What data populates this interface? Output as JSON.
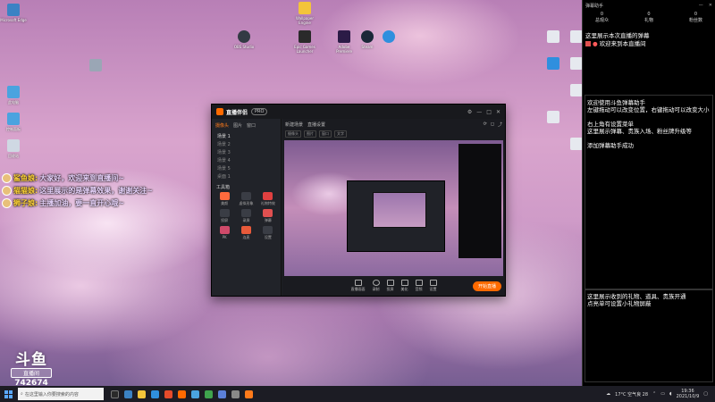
{
  "desktop": {
    "left_icons": [
      {
        "label": "Microsoft Edge",
        "color": "#3b82c4"
      },
      {
        "label": "",
        "color": "#9aa6b5"
      },
      {
        "label": "此电脑",
        "color": "#4aa3df"
      },
      {
        "label": "控制面板",
        "color": "#4aa3df"
      },
      {
        "label": "回收站",
        "color": "#cfd8e3"
      }
    ],
    "top_icons": [
      {
        "label": "OBS Studio",
        "color": "#333a44"
      },
      {
        "label": "Wallpaper Engine",
        "color": "#f3c43a"
      },
      {
        "label": "Epic Games Launcher",
        "color": "#2a2a2a"
      },
      {
        "label": "Adobe Premiere",
        "color": "#2b1b46"
      },
      {
        "label": "Steam",
        "color": "#1b2838"
      },
      {
        "label": "",
        "color": "#2f8fde"
      }
    ],
    "right_icons": [
      {
        "label": "",
        "color": "#e6e9ef"
      },
      {
        "label": "",
        "color": "#e6e9ef"
      },
      {
        "label": "",
        "color": "#2f8fde"
      },
      {
        "label": "",
        "color": "#e6e9ef"
      },
      {
        "label": "",
        "color": "#e6e9ef"
      },
      {
        "label": "",
        "color": "#e6e9ef"
      },
      {
        "label": "",
        "color": "#e6e9ef"
      }
    ]
  },
  "danmaku": [
    {
      "name": "鲨鱼娘:",
      "text": "大家好，欢迎来到直播间~"
    },
    {
      "name": "猫猫娘:",
      "text": "这里展示的是弹幕效果，谢谢关注~"
    },
    {
      "name": "狮子娘:",
      "text": "主播加油，要一直开心哦~"
    }
  ],
  "watermark": {
    "brand": "斗鱼",
    "sub": "直播间",
    "room_id": "742674"
  },
  "companion": {
    "title": "直播伴侣",
    "tag": "PRO",
    "tabs": [
      "摄像头",
      "图片",
      "窗口"
    ],
    "scenes": [
      "场景 1",
      "场景 2",
      "场景 3",
      "场景 4",
      "场景 5",
      "桌面 1"
    ],
    "tools_title": "工具箱",
    "tools": [
      "美颜",
      "虚拟形象",
      "礼物特效",
      "投屏",
      "录屏",
      "弹幕",
      "PK",
      "连麦",
      "设置"
    ],
    "topbar": [
      "新建场景",
      "直播设置"
    ],
    "toolrow": [
      "摄像头",
      "图片",
      "窗口",
      "文字"
    ],
    "bottom": [
      "直播画面",
      "录制",
      "投屏",
      "美化",
      "音频",
      "设置"
    ],
    "start_label": "开始直播"
  },
  "chat": {
    "title": "弹幕助手",
    "stats": [
      {
        "value": "0",
        "label": "总观众"
      },
      {
        "value": "0",
        "label": "礼物"
      },
      {
        "value": "0",
        "label": "粉丝数"
      }
    ],
    "header_msg": "这里展示本次直播的弹幕",
    "welcome_user": "欢迎来到本直播间",
    "box1": [
      "欢迎使用斗鱼弹幕助手",
      "左键拖动可以改变位置，右键拖动可以改变大小",
      "右上角有设置菜单",
      "这里展示弹幕、贵族入场、粉丝牌升级等",
      "添加弹幕助手成功"
    ],
    "box2": [
      "这里展示收到的礼物、道具、贵族开通",
      "点亮单可设置小礼物屏蔽"
    ]
  },
  "taskbar": {
    "search_placeholder": "在这里输入你要搜索的内容",
    "weather": "17°C 空气良 28",
    "time": "19:36",
    "date": "2021/10/9"
  }
}
